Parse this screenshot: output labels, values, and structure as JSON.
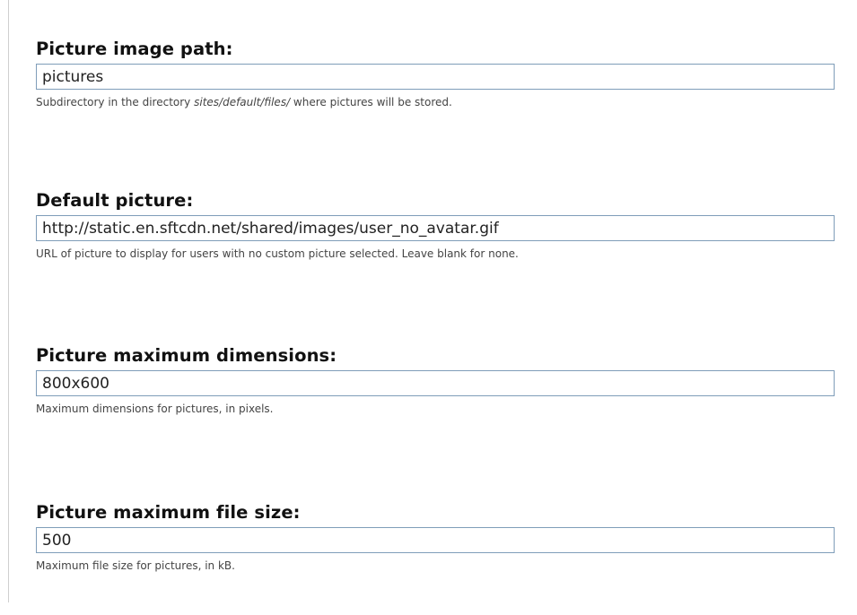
{
  "fields": [
    {
      "label": "Picture image path:",
      "value": "pictures",
      "description_before": "Subdirectory in the directory ",
      "description_path": "sites/default/files/",
      "description_after": " where pictures will be stored."
    },
    {
      "label": "Default picture:",
      "value": "http://static.en.sftcdn.net/shared/images/user_no_avatar.gif",
      "description": "URL of picture to display for users with no custom picture selected. Leave blank for none."
    },
    {
      "label": "Picture maximum dimensions:",
      "value": "800x600",
      "description": "Maximum dimensions for pictures, in pixels."
    },
    {
      "label": "Picture maximum file size:",
      "value": "500",
      "description": "Maximum file size for pictures, in kB."
    }
  ]
}
